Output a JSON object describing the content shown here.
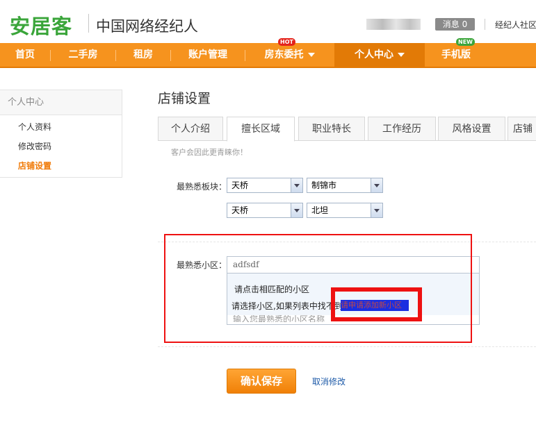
{
  "header": {
    "logo": "安居客",
    "subtitle": "中国网络经纪人",
    "message_badge": "消息 0",
    "community_link": "经纪人社区"
  },
  "nav": {
    "items": [
      {
        "label": "首页"
      },
      {
        "label": "二手房"
      },
      {
        "label": "租房"
      },
      {
        "label": "账户管理"
      },
      {
        "label": "房东委托",
        "tag": "HOT",
        "dropdown": true
      },
      {
        "label": "个人中心",
        "dropdown": true,
        "active": true
      },
      {
        "label": "手机版",
        "tag": "NEW"
      }
    ]
  },
  "sidebar": {
    "title": "个人中心",
    "items": [
      {
        "label": "个人资料"
      },
      {
        "label": "修改密码"
      },
      {
        "label": "店铺设置",
        "active": true
      }
    ]
  },
  "main": {
    "page_title": "店铺设置",
    "tabs": [
      {
        "label": "个人介绍"
      },
      {
        "label": "擅长区域",
        "active": true
      },
      {
        "label": "职业特长"
      },
      {
        "label": "工作经历"
      },
      {
        "label": "风格设置"
      },
      {
        "label": "店铺"
      }
    ],
    "hint": "客户会因此更青睐你！",
    "district_label": "最熟悉板块：",
    "selects": [
      {
        "value": "天桥"
      },
      {
        "value": "制锦市"
      },
      {
        "value": "天桥"
      },
      {
        "value": "北坦"
      }
    ],
    "community_label": "最熟悉小区：",
    "community_input_value": "adfsdf",
    "dropdown": {
      "option": "请点击相匹配的小区",
      "message": "请选择小区,如果列表中找不到",
      "link": "请申请添加新小区",
      "placeholder": "输入您最熟悉的小区名称"
    },
    "save_button": "确认保存",
    "cancel_link": "取消修改"
  },
  "colors": {
    "brand_green": "#3aa53a",
    "nav_orange": "#f6931e",
    "nav_active": "#e27a06",
    "annotation_red": "#ee1111"
  }
}
